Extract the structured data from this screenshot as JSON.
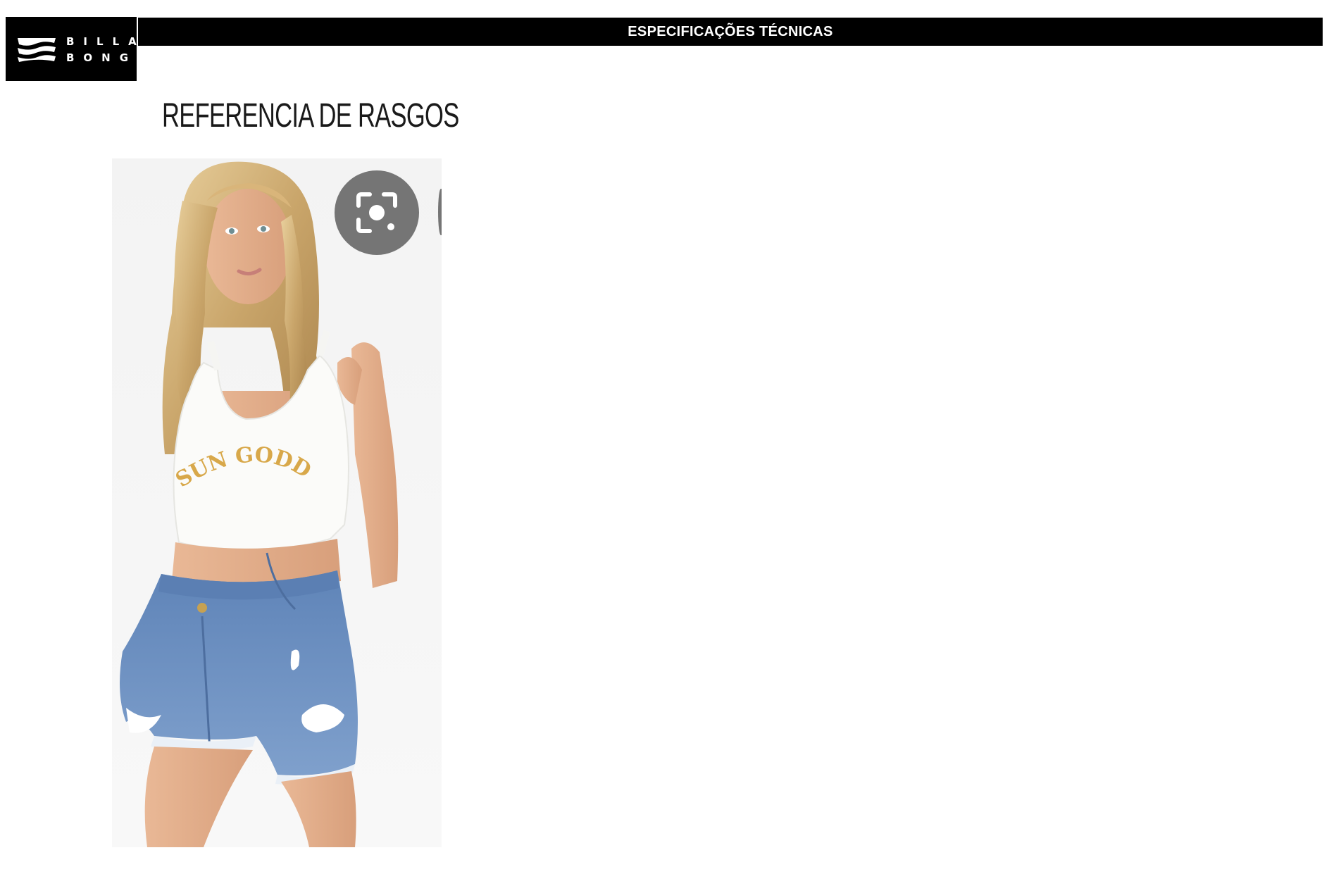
{
  "header": {
    "brand_line1": "BILLA",
    "brand_line2": "BONG",
    "title": "ESPECIFICAÇÕES TÉCNICAS"
  },
  "section": {
    "title": "REFERENCIA DE RASGOS"
  },
  "reference_photo": {
    "print_text": "SUN GODDESS"
  },
  "icons": {
    "lens": "google-lens-icon"
  },
  "colors": {
    "header_bar": "#000000",
    "header_text": "#ffffff",
    "print_mustard": "#d8a84a",
    "denim": "#6f93c2",
    "lens_button": "#757575"
  }
}
